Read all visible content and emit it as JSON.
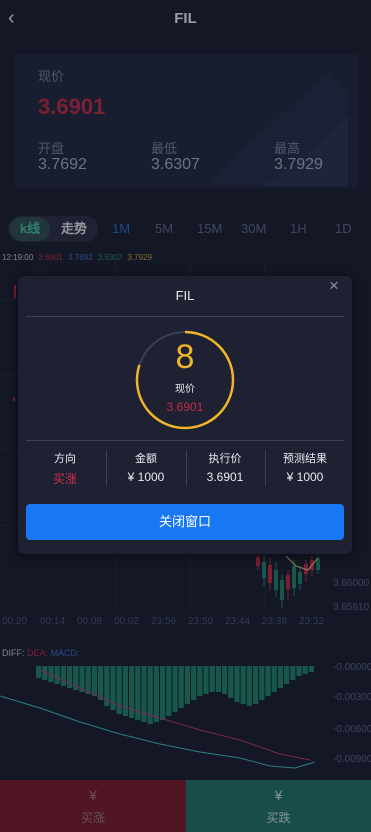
{
  "header": {
    "title": "FIL",
    "back_icon": "‹"
  },
  "price_card": {
    "current_label": "现价",
    "current_value": "3.6901",
    "open_label": "开盘",
    "open_value": "3.7692",
    "low_label": "最低",
    "low_value": "3.6307",
    "high_label": "最高",
    "high_value": "3.7929"
  },
  "tabs": {
    "kline": "k线",
    "trend": "走势",
    "intervals": [
      "1M",
      "5M",
      "15M",
      "30M",
      "1H",
      "1D"
    ],
    "active_interval": "1M"
  },
  "ohlc": {
    "time": "12:19:00",
    "o": "3.6901",
    "h": "3.7692",
    "l": "3.6307",
    "c": "3.7929"
  },
  "chart": {
    "time_labels": [
      "00:20",
      "00:14",
      "00:08",
      "00:02",
      "23:56",
      "23:50",
      "23:44",
      "23:38",
      "23:32"
    ],
    "price_labels": [
      "3.66000",
      "3.65610"
    ],
    "macd_legend": {
      "diff": "DIFF:",
      "dea": "DEA:",
      "macd": "MACD:"
    },
    "macd_labels": [
      "-0.00000",
      "-0.00300",
      "-0.00600",
      "-0.00900"
    ],
    "colors": {
      "up": "#c12d48",
      "down": "#21866f",
      "dea": "#b83a7e",
      "diff": "#3fc7c0"
    }
  },
  "modal": {
    "title": "FIL",
    "close_icon": "×",
    "countdown": "8",
    "countdown_progress": 0.8,
    "price_label": "现价",
    "price_value": "3.6901",
    "columns": [
      {
        "header": "方向",
        "value": "买涨"
      },
      {
        "header": "金额",
        "value": "¥ 1000"
      },
      {
        "header": "执行价",
        "value": "3.6901"
      },
      {
        "header": "预测结果",
        "value": "¥ 1000"
      }
    ],
    "close_button": "关闭窗口"
  },
  "bottom": {
    "buy_label": "买涨",
    "sell_label": "买跌",
    "buy_icon": "¥",
    "sell_icon": "¥"
  }
}
